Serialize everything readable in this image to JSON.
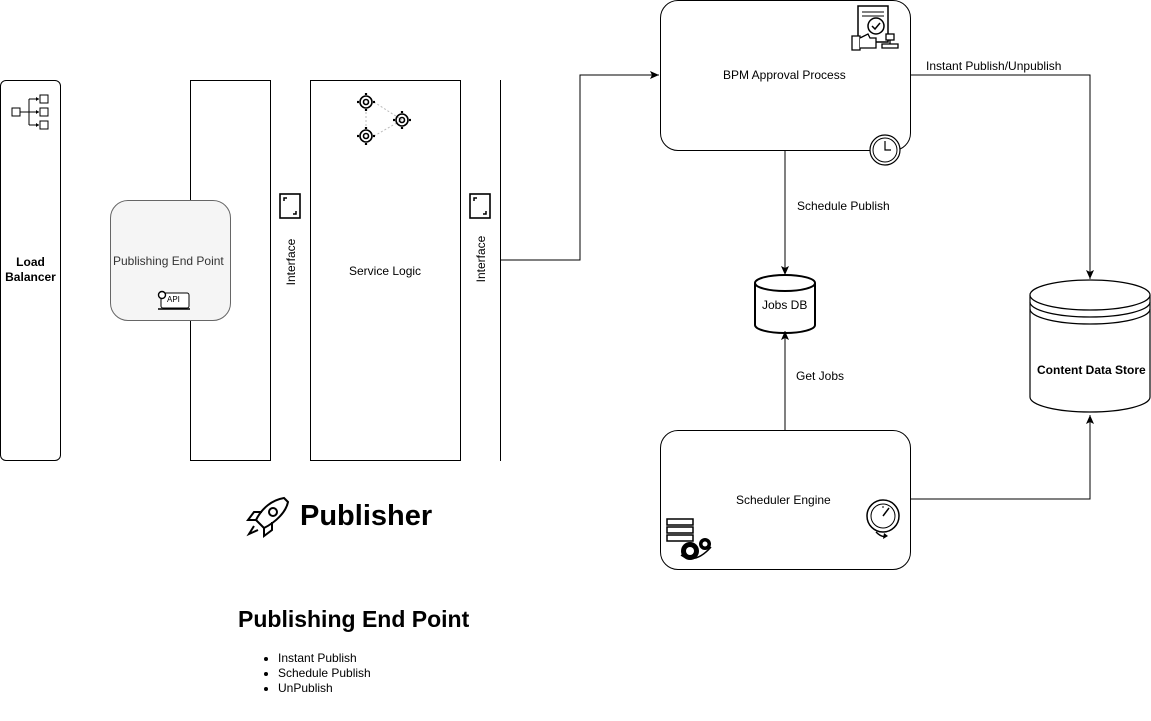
{
  "load_balancer": {
    "label": "Load Balancer"
  },
  "publisher": {
    "endpoint_label": "Publishing End Point",
    "api_label": "API",
    "interface_left": "Interface",
    "service_logic": "Service Logic",
    "interface_right": "Interface",
    "title": "Publisher"
  },
  "bpm": {
    "label": "BPM Approval Process"
  },
  "jobs_db": {
    "label": "Jobs DB"
  },
  "content_store": {
    "label": "Content Data Store"
  },
  "scheduler": {
    "label": "Scheduler Engine"
  },
  "edges": {
    "instant_publish": "Instant Publish/Unpublish",
    "schedule_publish": "Schedule Publish",
    "get_jobs": "Get Jobs"
  },
  "notes": {
    "title": "Publishing End Point",
    "items": [
      "Instant Publish",
      "Schedule Publish",
      "UnPublish"
    ]
  }
}
